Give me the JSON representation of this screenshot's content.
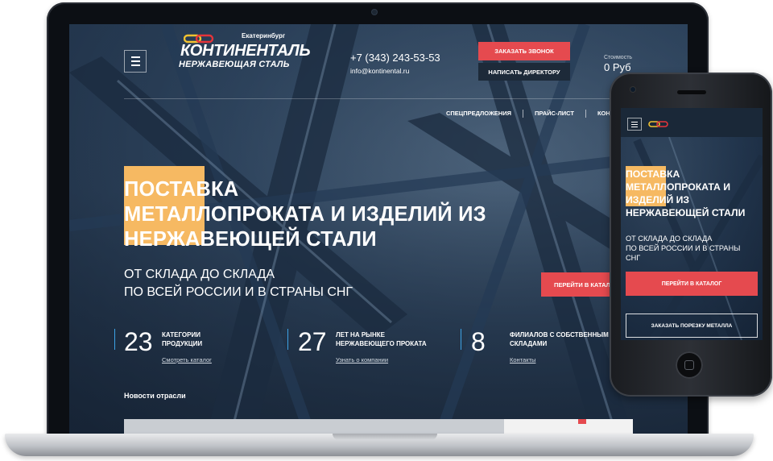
{
  "site": {
    "city": "Екатеринбург",
    "logo_main": "КОНТИНЕНТАЛЬ",
    "logo_sub": "НЕРЖАВЕЮЩАЯ СТАЛЬ",
    "phone": "+7 (343) 243-53-53",
    "email": "info@kontinental.ru",
    "buttons": {
      "call": "ЗАКАЗАТЬ ЗВОНОК",
      "director": "НАПИСАТЬ ДИРЕКТОРУ",
      "catalog": "ПЕРЕЙТИ В КАТАЛ",
      "catalog_full": "ПЕРЕЙТИ В КАТАЛОГ",
      "cut": "ЗАКАЗАТЬ ПОРЕЗКУ МЕТАЛЛА"
    },
    "cart": {
      "label": "Стоимость",
      "value": "0 Руб"
    },
    "nav": [
      "СПЕЦПРЕДЛОЖЕНИЯ",
      "ПРАЙС-ЛИСТ",
      "КОН"
    ],
    "hero": {
      "title_lines": [
        "ПОСТАВКА",
        "МЕТАЛЛОПРОКАТА И ИЗДЕЛИЙ ИЗ",
        "НЕРЖАВЕЮЩЕЙ СТАЛИ"
      ],
      "subtitle_lines": [
        "ОТ СКЛАДА ДО СКЛАДА",
        "ПО ВСЕЙ РОССИИ И В СТРАНЫ СНГ"
      ]
    },
    "stats": [
      {
        "number": "23",
        "label_lines": [
          "КАТЕГОРИИ",
          "ПРОДУКЦИИ"
        ],
        "link": "Смотреть каталог"
      },
      {
        "number": "27",
        "label_lines": [
          "ЛЕТ НА РЫНКЕ",
          "НЕРЖАВЕЮЩЕГО ПРОКАТА"
        ],
        "link": "Узнать о компании"
      },
      {
        "number": "8",
        "label_lines": [
          "ФИЛИАЛОВ С СОБСТВЕННЫМ",
          "СКЛАДАМИ"
        ],
        "link": "Контакты"
      }
    ],
    "news_title": "Новости отрасли"
  },
  "mobile": {
    "title_lines": [
      "ПОСТАВКА",
      "МЕТАЛЛОПРОКАТА И",
      "ИЗДЕЛИЙ ИЗ",
      "НЕРЖАВЕЮЩЕЙ СТАЛИ"
    ],
    "subtitle_lines": [
      "ОТ СКЛАДА ДО СКЛАДА",
      "ПО ВСЕЙ РОССИИ И В СТРАНЫ",
      "СНГ"
    ]
  },
  "colors": {
    "accent_red": "#e54a4f",
    "accent_orange": "#f6b962",
    "stat_bar_blue": "#3da3e6",
    "dark_button": "#1d2a39",
    "logo_chain_yellow": "#f2c230",
    "logo_chain_red": "#e5343a"
  },
  "icons": [
    "hamburger-menu-icon",
    "chain-logo-icon"
  ]
}
